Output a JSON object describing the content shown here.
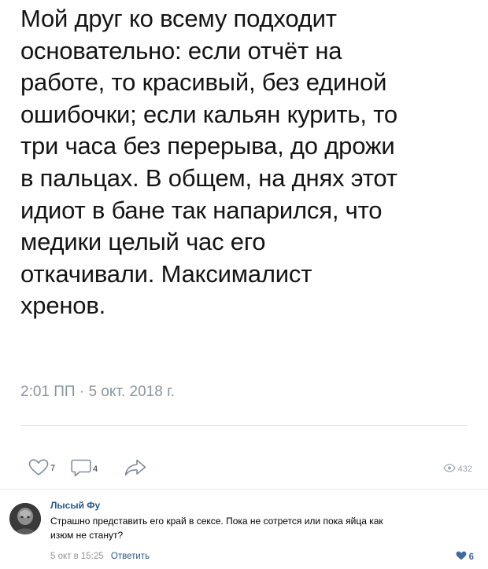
{
  "post": {
    "text_lines": [
      "Мой друг ко всему подходит",
      "основательно: если отчёт на",
      "работе, то красивый, без единой",
      "ошибочки; если кальян курить, то",
      "три часа без перерыва, до дрожи",
      "в пальцах. В общем, на днях этот",
      "идиот в бане так напарился, что",
      "медики целый час его",
      "откачивали. Максималист",
      "хренов."
    ],
    "timestamp": "2:01 ПП · 5 окт. 2018 г."
  },
  "actions": {
    "likes": "7",
    "comments": "4",
    "views": "432",
    "icons": {
      "like": "heart-outline-icon",
      "comment": "comment-bubble-icon",
      "share": "share-arrow-icon",
      "views": "eye-icon"
    },
    "icon_color": "#818c99"
  },
  "comment": {
    "author": "Лысый Фу",
    "text_lines": [
      "Страшно представить его край в сексе. Пока не сотрется или пока яйца как",
      "изюм не станут?"
    ],
    "date": "5 окт в 15:25",
    "reply_label": "Ответить",
    "likes": "6",
    "link_color": "#2a5885"
  }
}
